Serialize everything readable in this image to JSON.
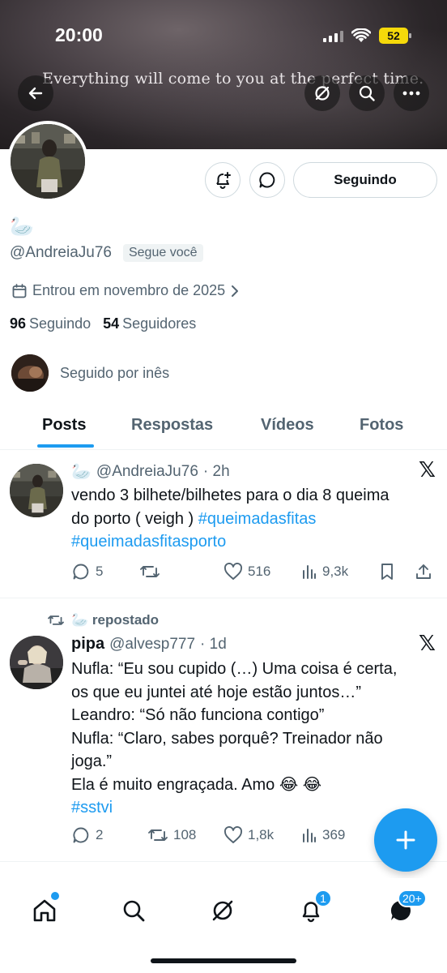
{
  "status_bar": {
    "time": "20:00",
    "battery": "52"
  },
  "banner": {
    "quote": "Everything will come to you at the perfect time."
  },
  "profile": {
    "display_name": "🦢",
    "handle": "@AndreiaJu76",
    "follows_you": "Segue você",
    "joined": "Entrou em novembro de 2025",
    "following_count": "96",
    "following_label": "Seguindo",
    "followers_count": "54",
    "followers_label": "Seguidores",
    "followed_by": "Seguido por inês",
    "follow_button": "Seguindo"
  },
  "tabs": [
    "Posts",
    "Respostas",
    "Vídeos",
    "Fotos"
  ],
  "posts": [
    {
      "name": "🦢",
      "handle": "@AndreiaJu76",
      "time": "· 2h",
      "text_line1": "vendo 3 bilhete/bilhetes para o dia 8 queima",
      "text_line2": "do porto ( veigh ) ",
      "tag1": "#queimadasfitas",
      "tag2": "#queimadasfitasporto",
      "replies": "5",
      "reposts": "",
      "likes": "516",
      "views": "9,3k"
    },
    {
      "repost_label": "🦢  repostado",
      "name": "pipa",
      "handle": "@alvesp777",
      "time": "· 1d",
      "lines": [
        "Nufla: “Eu sou cupido (…) Uma coisa é certa,",
        "os que eu juntei até hoje estão juntos…”",
        "Leandro: “Só não funciona contigo”",
        "Nufla: “Claro, sabes porquê? Treinador não",
        "joga.”",
        "Ela é muito engraçada. Amo 😂 😂"
      ],
      "tag": "#sstvi",
      "replies": "2",
      "reposts": "108",
      "likes": "1,8k",
      "views": "369"
    }
  ],
  "nav": {
    "notifications_badge": "1",
    "messages_badge": "20+"
  },
  "colors": {
    "accent": "#1d9bf0",
    "secondary_text": "#536471",
    "text": "#0f1419"
  }
}
